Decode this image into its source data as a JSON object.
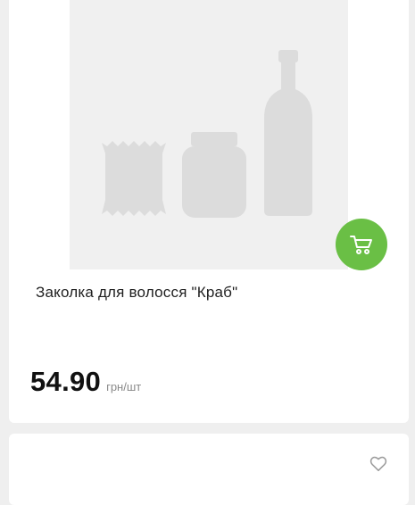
{
  "product": {
    "title": "Заколка для волосся \"Краб\"",
    "price": "54.90",
    "unit": "грн/шт",
    "image_icon": "placeholder-products-image",
    "cart_icon": "shopping-cart-icon",
    "cart_color": "#6abf45"
  },
  "next_card": {
    "favorite_icon": "heart-outline-icon"
  }
}
